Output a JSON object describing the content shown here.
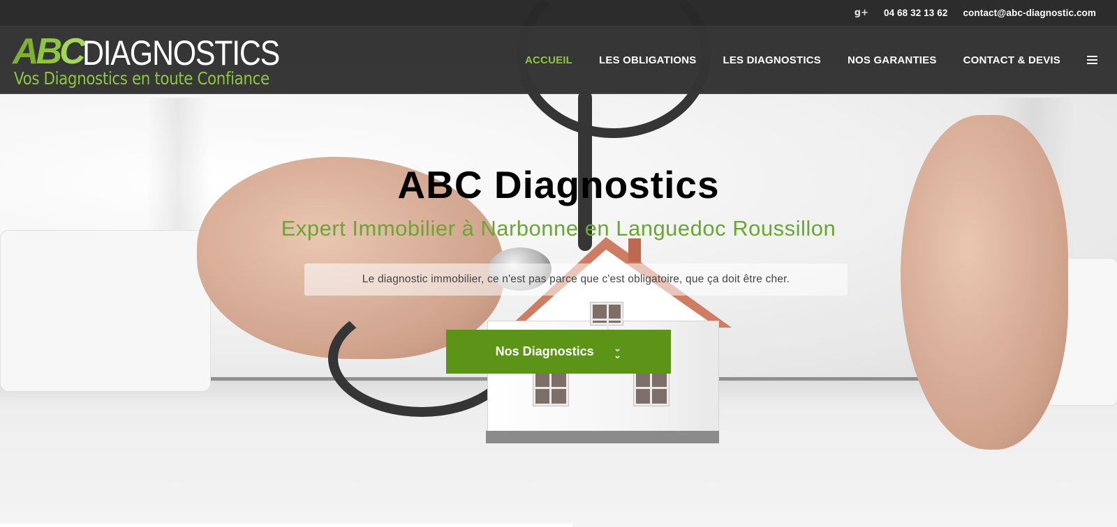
{
  "topbar": {
    "gplus_icon": "google-plus-icon",
    "gplus_glyph": "g+",
    "phone": "04 68 32 13 62",
    "email": "contact@abc-diagnostic.com"
  },
  "logo": {
    "abc_a": "A",
    "abc_b": "B",
    "abc_c": "C",
    "wordmark": "DIAGNOSTICS",
    "tagline": "Vos Diagnostics en toute Confiance"
  },
  "nav": {
    "items": [
      {
        "label": "ACCUEIL",
        "active": true
      },
      {
        "label": "LES OBLIGATIONS",
        "active": false
      },
      {
        "label": "LES DIAGNOSTICS",
        "active": false
      },
      {
        "label": "NOS GARANTIES",
        "active": false
      },
      {
        "label": "CONTACT & DEVIS",
        "active": false
      }
    ],
    "menu_icon": "hamburger-icon"
  },
  "hero": {
    "title": "ABC Diagnostics",
    "subtitle": "Expert Immobilier à Narbonne en Languedoc Roussillon",
    "tagline": "Le diagnostic immobilier, ce n'est pas parce que c'est obligatoire, que ça doit être cher.",
    "cta_label": "Nos Diagnostics",
    "cta_icon": "double-chevron-down-icon",
    "cta_glyph_top": "⌄",
    "cta_glyph_bottom": "⌄"
  },
  "colors": {
    "accent_green": "#8ec63f",
    "button_green": "#5c9417",
    "subtitle_green": "#6aa632",
    "navbar_dark": "#343434"
  }
}
